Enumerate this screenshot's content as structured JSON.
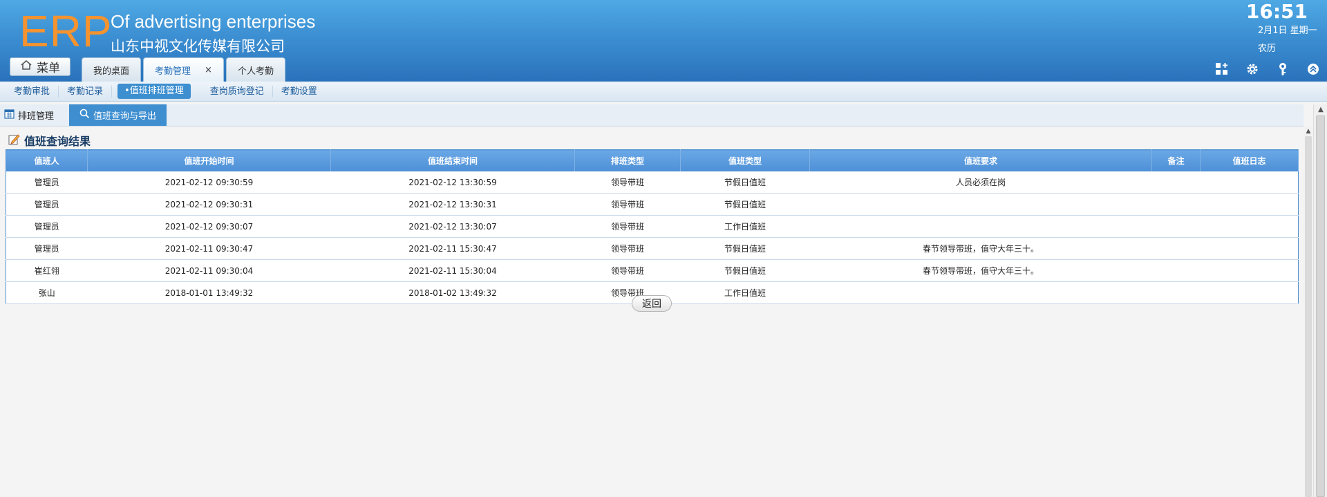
{
  "header": {
    "logo": "ERP",
    "company_en": "Of advertising enterprises",
    "company_cn": "山东中视文化传媒有限公司",
    "menu_label": "菜单",
    "tabs": [
      {
        "label": "我的桌面"
      },
      {
        "label": "考勤管理",
        "close": "×"
      },
      {
        "label": "个人考勤"
      }
    ],
    "time": "16:51",
    "date": "2月1日 星期一",
    "lunar": "农历",
    "icons": [
      "grid-add-icon",
      "gear-icon",
      "key-icon",
      "collapse-up-icon"
    ]
  },
  "subnav": {
    "items": [
      {
        "label": "考勤审批"
      },
      {
        "label": "考勤记录"
      },
      {
        "label": "•值班排班管理"
      },
      {
        "label": "查岗质询登记"
      },
      {
        "label": "考勤设置"
      }
    ]
  },
  "subtabs": [
    {
      "label": "排班管理"
    },
    {
      "label": "值班查询与导出"
    }
  ],
  "section_title": "值班查询结果",
  "table": {
    "headers": [
      "值班人",
      "值班开始时间",
      "值班结束时间",
      "排班类型",
      "值班类型",
      "值班要求",
      "备注",
      "值班日志"
    ],
    "rows": [
      [
        "管理员",
        "2021-02-12 09:30:59",
        "2021-02-12 13:30:59",
        "领导带班",
        "节假日值班",
        "人员必须在岗",
        "",
        ""
      ],
      [
        "管理员",
        "2021-02-12 09:30:31",
        "2021-02-12 13:30:31",
        "领导带班",
        "节假日值班",
        "",
        "",
        ""
      ],
      [
        "管理员",
        "2021-02-12 09:30:07",
        "2021-02-12 13:30:07",
        "领导带班",
        "工作日值班",
        "",
        "",
        ""
      ],
      [
        "管理员",
        "2021-02-11 09:30:47",
        "2021-02-11 15:30:47",
        "领导带班",
        "节假日值班",
        "春节领导带班，值守大年三十。",
        "",
        ""
      ],
      [
        "崔红翎",
        "2021-02-11 09:30:04",
        "2021-02-11 15:30:04",
        "领导带班",
        "节假日值班",
        "春节领导带班，值守大年三十。",
        "",
        ""
      ],
      [
        "张山",
        "2018-01-01 13:49:32",
        "2018-01-02 13:49:32",
        "领导带班",
        "工作日值班",
        "",
        "",
        ""
      ]
    ]
  },
  "back_label": "返回",
  "colors": {
    "header_blue": "#3c8fd2",
    "logo_orange": "#f4932f",
    "table_header": "#4d8fd6",
    "active_tab": "#3e8ed0"
  }
}
